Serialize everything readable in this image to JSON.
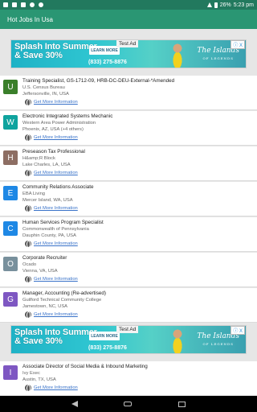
{
  "status_bar": {
    "battery": "26%",
    "time": "5:23 pm",
    "icons": [
      "notification-icon",
      "notification-icon",
      "notification-icon",
      "notification-icon",
      "notification-icon",
      "wifi-icon",
      "battery-icon"
    ]
  },
  "app_bar": {
    "title": "Hot Jobs In Usa"
  },
  "ad": {
    "headline_line1": "Splash Into Summer",
    "headline_line2": "& Save 30%",
    "cta": "LEARN MORE",
    "phone": "(833) 275-8876",
    "badge": "Test Ad",
    "brand": "The Islands",
    "brand_sub": "OF LEGENDS",
    "close": "ⓘ X"
  },
  "jobs": [
    {
      "letter": "U",
      "color": "#3a7f2a",
      "title": "Training Specialist, GS-1712-09, HRB-DC-DEU-External-*Amended",
      "company": "U.S. Census Bureau",
      "location": "Jeffersonville, IN, USA",
      "link": "Get More Information"
    },
    {
      "letter": "W",
      "color": "#0fa39e",
      "title": "Electronic Integrated Systems Mechanic",
      "company": "Western Area Power Administration",
      "location": "Phoenix, AZ, USA (+4 others)",
      "link": "Get More Information"
    },
    {
      "letter": "H",
      "color": "#8d6e63",
      "title": "Preseason Tax Professional",
      "company": "H&amp;R Block",
      "location": "Lake Charles, LA, USA",
      "link": "Get More Information"
    },
    {
      "letter": "E",
      "color": "#1e88e5",
      "title": "Community Relations Associate",
      "company": "EBA Living",
      "location": "Mercer Island, WA, USA",
      "link": "Get More Information"
    },
    {
      "letter": "C",
      "color": "#1e88e5",
      "title": "Human Services Program Specialist",
      "company": "Commonwealth of Pennsylvania",
      "location": "Dauphin County, PA, USA",
      "link": "Get More Information"
    },
    {
      "letter": "O",
      "color": "#78909c",
      "title": "Corporate Recruiter",
      "company": "Ocado",
      "location": "Vienna, VA, USA",
      "link": "Get More Information"
    },
    {
      "letter": "G",
      "color": "#7e57c2",
      "title": "Manager, Accounting (Re-advertised)",
      "company": "Guilford Technical Community College",
      "location": "Jamestown, NC, USA",
      "link": "Get More Information"
    },
    {
      "letter": "I",
      "color": "#7e57c2",
      "title": "Associate Director of Social Media & Inbound Marketing",
      "company": "Ivy Exec",
      "location": "Austin, TX, USA",
      "link": "Get More Information"
    }
  ]
}
